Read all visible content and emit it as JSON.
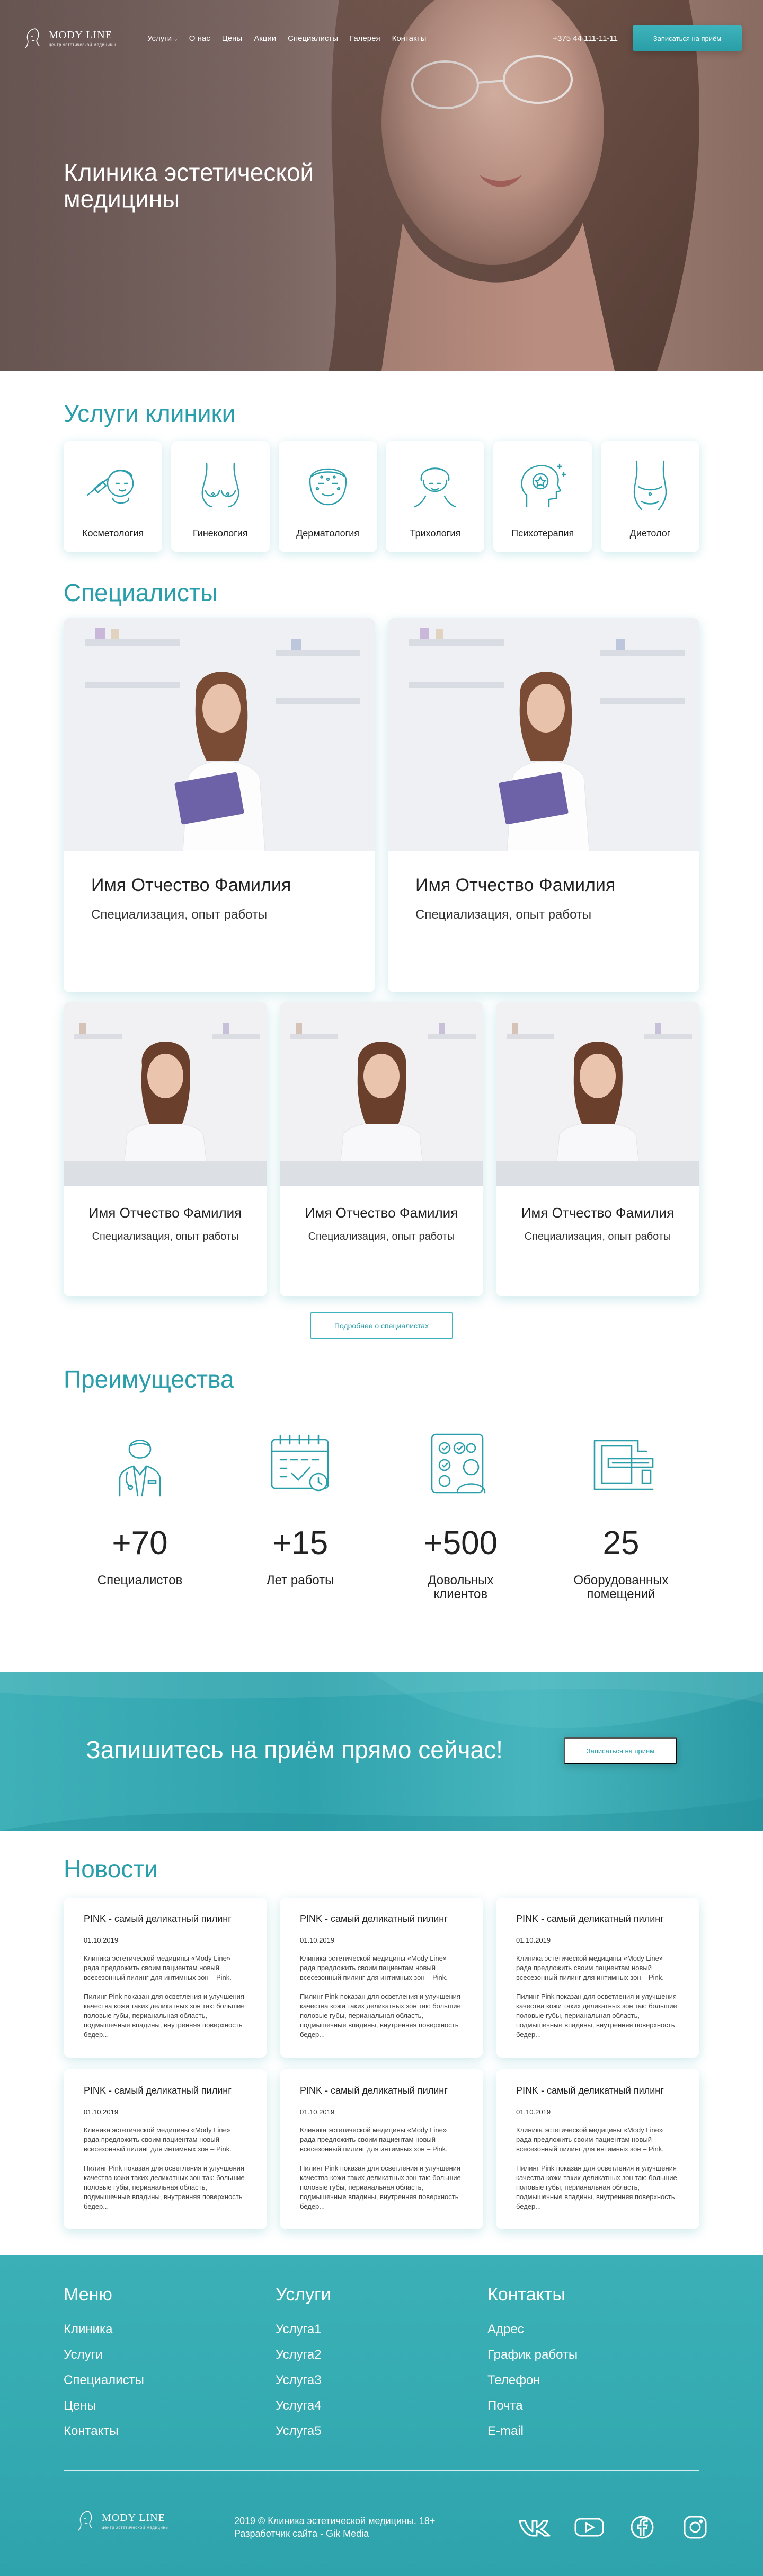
{
  "header": {
    "logo": {
      "title": "MODY LINE",
      "subtitle": "центр эстетической медицины"
    },
    "nav": [
      "Услуги",
      "О нас",
      "Цены",
      "Акции",
      "Специалисты",
      "Галерея",
      "Контакты"
    ],
    "phone": "+375 44 111-11-11",
    "cta_label": "Записаться на приём"
  },
  "hero": {
    "title": "Клиника эстетической медицины"
  },
  "services": {
    "title": "Услуги клиники",
    "items": [
      {
        "label": "Косметология",
        "icon": "cosmetology-icon"
      },
      {
        "label": "Гинекология",
        "icon": "gynecology-icon"
      },
      {
        "label": "Дерматология",
        "icon": "dermatology-icon"
      },
      {
        "label": "Трихология",
        "icon": "trichology-icon"
      },
      {
        "label": "Психотерапия",
        "icon": "psychotherapy-icon"
      },
      {
        "label": "Диетолог",
        "icon": "dietology-icon"
      }
    ]
  },
  "specialists": {
    "title": "Специалисты",
    "cards": [
      {
        "name": "Имя Отчество Фамилия",
        "role": "Специализация, опыт работы"
      },
      {
        "name": "Имя Отчество Фамилия",
        "role": "Специализация, опыт работы"
      },
      {
        "name": "Имя Отчество Фамилия",
        "role": "Специализация, опыт работы"
      },
      {
        "name": "Имя Отчество Фамилия",
        "role": "Специализация, опыт работы"
      },
      {
        "name": "Имя Отчество Фамилия",
        "role": "Специализация, опыт работы"
      }
    ],
    "more_label": "Подробнее о специалистах"
  },
  "advantages": {
    "title": "Преимущества",
    "items": [
      {
        "number": "+70",
        "label": "Специалистов",
        "icon": "doctor-icon"
      },
      {
        "number": "+15",
        "label": "Лет работы",
        "icon": "calendar-icon"
      },
      {
        "number": "+500",
        "label": "Довольных клиентов",
        "icon": "clients-icon"
      },
      {
        "number": "25",
        "label": "Оборудованных помещений",
        "icon": "equipment-icon"
      }
    ]
  },
  "cta": {
    "text": "Запишитесь на приём прямо сейчас!",
    "button": "Записаться на приём"
  },
  "news": {
    "title": "Новости",
    "items": [
      {
        "title": "PINK - самый деликатный пилинг",
        "date": "01.10.2019",
        "p1": "Клиника эстетической медицины «Mody Line» рада предложить своим пациентам новый всесезонный пилинг для интимных зон – Pink.",
        "p2": "Пилинг Pink показан для осветления и улучшения качества кожи таких деликатных зон так: большие половые губы, перианальная область, подмышечные впадины, внутренняя поверхность бедер..."
      },
      {
        "title": "PINK - самый деликатный пилинг",
        "date": "01.10.2019",
        "p1": "Клиника эстетической медицины «Mody Line» рада предложить своим пациентам новый всесезонный пилинг для интимных зон – Pink.",
        "p2": "Пилинг Pink показан для осветления и улучшения качества кожи таких деликатных зон так: большие половые губы, перианальная область, подмышечные впадины, внутренняя поверхность бедер..."
      },
      {
        "title": "PINK - самый деликатный пилинг",
        "date": "01.10.2019",
        "p1": "Клиника эстетической медицины «Mody Line» рада предложить своим пациентам новый всесезонный пилинг для интимных зон – Pink.",
        "p2": "Пилинг Pink показан для осветления и улучшения качества кожи таких деликатных зон так: большие половые губы, перианальная область, подмышечные впадины, внутренняя поверхность бедер..."
      },
      {
        "title": "PINK - самый деликатный пилинг",
        "date": "01.10.2019",
        "p1": "Клиника эстетической медицины «Mody Line» рада предложить своим пациентам новый всесезонный пилинг для интимных зон – Pink.",
        "p2": "Пилинг Pink показан для осветления и улучшения качества кожи таких деликатных зон так: большие половые губы, перианальная область, подмышечные впадины, внутренняя поверхность бедер..."
      },
      {
        "title": "PINK - самый деликатный пилинг",
        "date": "01.10.2019",
        "p1": "Клиника эстетической медицины «Mody Line» рада предложить своим пациентам новый всесезонный пилинг для интимных зон – Pink.",
        "p2": "Пилинг Pink показан для осветления и улучшения качества кожи таких деликатных зон так: большие половые губы, перианальная область, подмышечные впадины, внутренняя поверхность бедер..."
      },
      {
        "title": "PINK - самый деликатный пилинг",
        "date": "01.10.2019",
        "p1": "Клиника эстетической медицины «Mody Line» рада предложить своим пациентам новый всесезонный пилинг для интимных зон – Pink.",
        "p2": "Пилинг Pink показан для осветления и улучшения качества кожи таких деликатных зон так: большие половые губы, перианальная область, подмышечные впадины, внутренняя поверхность бедер..."
      }
    ]
  },
  "footer": {
    "menu": {
      "title": "Меню",
      "links": [
        "Клиника",
        "Услуги",
        "Специалисты",
        "Цены",
        "Контакты"
      ]
    },
    "services": {
      "title": "Услуги",
      "links": [
        "Услуга1",
        "Услуга2",
        "Услуга3",
        "Услуга4",
        "Услуга5"
      ]
    },
    "contacts": {
      "title": "Контакты",
      "links": [
        "Адрес",
        "График работы",
        "Телефон",
        "Почта",
        "E-mail"
      ]
    },
    "copyright": "2019 © Клиника эстетической медицины. 18+ Разработчик сайта - Gik Media",
    "socials": [
      "vk-icon",
      "youtube-icon",
      "facebook-icon",
      "instagram-icon"
    ]
  },
  "colors": {
    "accent": "#2a9fab",
    "accent_light": "#3fb3bb",
    "footer_bg": "#34aab2"
  }
}
